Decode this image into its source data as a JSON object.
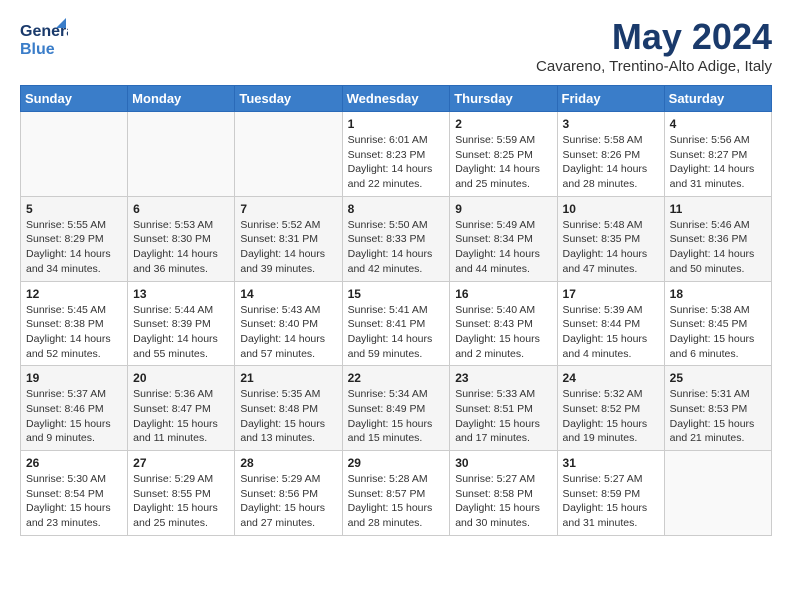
{
  "header": {
    "logo_general": "General",
    "logo_blue": "Blue",
    "month_title": "May 2024",
    "subtitle": "Cavareno, Trentino-Alto Adige, Italy"
  },
  "days_of_week": [
    "Sunday",
    "Monday",
    "Tuesday",
    "Wednesday",
    "Thursday",
    "Friday",
    "Saturday"
  ],
  "weeks": [
    [
      {
        "day": "",
        "info": ""
      },
      {
        "day": "",
        "info": ""
      },
      {
        "day": "",
        "info": ""
      },
      {
        "day": "1",
        "info": "Sunrise: 6:01 AM\nSunset: 8:23 PM\nDaylight: 14 hours\nand 22 minutes."
      },
      {
        "day": "2",
        "info": "Sunrise: 5:59 AM\nSunset: 8:25 PM\nDaylight: 14 hours\nand 25 minutes."
      },
      {
        "day": "3",
        "info": "Sunrise: 5:58 AM\nSunset: 8:26 PM\nDaylight: 14 hours\nand 28 minutes."
      },
      {
        "day": "4",
        "info": "Sunrise: 5:56 AM\nSunset: 8:27 PM\nDaylight: 14 hours\nand 31 minutes."
      }
    ],
    [
      {
        "day": "5",
        "info": "Sunrise: 5:55 AM\nSunset: 8:29 PM\nDaylight: 14 hours\nand 34 minutes."
      },
      {
        "day": "6",
        "info": "Sunrise: 5:53 AM\nSunset: 8:30 PM\nDaylight: 14 hours\nand 36 minutes."
      },
      {
        "day": "7",
        "info": "Sunrise: 5:52 AM\nSunset: 8:31 PM\nDaylight: 14 hours\nand 39 minutes."
      },
      {
        "day": "8",
        "info": "Sunrise: 5:50 AM\nSunset: 8:33 PM\nDaylight: 14 hours\nand 42 minutes."
      },
      {
        "day": "9",
        "info": "Sunrise: 5:49 AM\nSunset: 8:34 PM\nDaylight: 14 hours\nand 44 minutes."
      },
      {
        "day": "10",
        "info": "Sunrise: 5:48 AM\nSunset: 8:35 PM\nDaylight: 14 hours\nand 47 minutes."
      },
      {
        "day": "11",
        "info": "Sunrise: 5:46 AM\nSunset: 8:36 PM\nDaylight: 14 hours\nand 50 minutes."
      }
    ],
    [
      {
        "day": "12",
        "info": "Sunrise: 5:45 AM\nSunset: 8:38 PM\nDaylight: 14 hours\nand 52 minutes."
      },
      {
        "day": "13",
        "info": "Sunrise: 5:44 AM\nSunset: 8:39 PM\nDaylight: 14 hours\nand 55 minutes."
      },
      {
        "day": "14",
        "info": "Sunrise: 5:43 AM\nSunset: 8:40 PM\nDaylight: 14 hours\nand 57 minutes."
      },
      {
        "day": "15",
        "info": "Sunrise: 5:41 AM\nSunset: 8:41 PM\nDaylight: 14 hours\nand 59 minutes."
      },
      {
        "day": "16",
        "info": "Sunrise: 5:40 AM\nSunset: 8:43 PM\nDaylight: 15 hours\nand 2 minutes."
      },
      {
        "day": "17",
        "info": "Sunrise: 5:39 AM\nSunset: 8:44 PM\nDaylight: 15 hours\nand 4 minutes."
      },
      {
        "day": "18",
        "info": "Sunrise: 5:38 AM\nSunset: 8:45 PM\nDaylight: 15 hours\nand 6 minutes."
      }
    ],
    [
      {
        "day": "19",
        "info": "Sunrise: 5:37 AM\nSunset: 8:46 PM\nDaylight: 15 hours\nand 9 minutes."
      },
      {
        "day": "20",
        "info": "Sunrise: 5:36 AM\nSunset: 8:47 PM\nDaylight: 15 hours\nand 11 minutes."
      },
      {
        "day": "21",
        "info": "Sunrise: 5:35 AM\nSunset: 8:48 PM\nDaylight: 15 hours\nand 13 minutes."
      },
      {
        "day": "22",
        "info": "Sunrise: 5:34 AM\nSunset: 8:49 PM\nDaylight: 15 hours\nand 15 minutes."
      },
      {
        "day": "23",
        "info": "Sunrise: 5:33 AM\nSunset: 8:51 PM\nDaylight: 15 hours\nand 17 minutes."
      },
      {
        "day": "24",
        "info": "Sunrise: 5:32 AM\nSunset: 8:52 PM\nDaylight: 15 hours\nand 19 minutes."
      },
      {
        "day": "25",
        "info": "Sunrise: 5:31 AM\nSunset: 8:53 PM\nDaylight: 15 hours\nand 21 minutes."
      }
    ],
    [
      {
        "day": "26",
        "info": "Sunrise: 5:30 AM\nSunset: 8:54 PM\nDaylight: 15 hours\nand 23 minutes."
      },
      {
        "day": "27",
        "info": "Sunrise: 5:29 AM\nSunset: 8:55 PM\nDaylight: 15 hours\nand 25 minutes."
      },
      {
        "day": "28",
        "info": "Sunrise: 5:29 AM\nSunset: 8:56 PM\nDaylight: 15 hours\nand 27 minutes."
      },
      {
        "day": "29",
        "info": "Sunrise: 5:28 AM\nSunset: 8:57 PM\nDaylight: 15 hours\nand 28 minutes."
      },
      {
        "day": "30",
        "info": "Sunrise: 5:27 AM\nSunset: 8:58 PM\nDaylight: 15 hours\nand 30 minutes."
      },
      {
        "day": "31",
        "info": "Sunrise: 5:27 AM\nSunset: 8:59 PM\nDaylight: 15 hours\nand 31 minutes."
      },
      {
        "day": "",
        "info": ""
      }
    ]
  ]
}
